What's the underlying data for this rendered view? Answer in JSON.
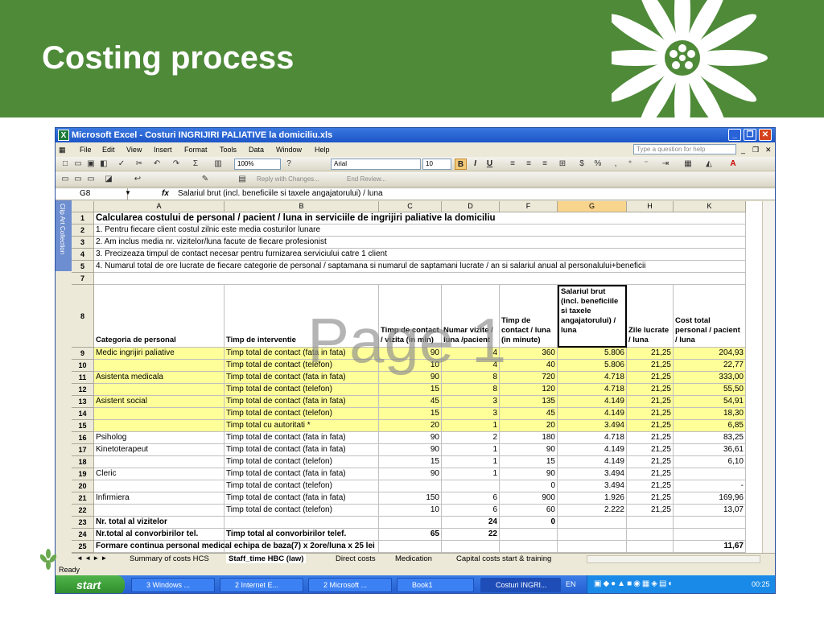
{
  "slide": {
    "title": "Costing process"
  },
  "window": {
    "title": "Microsoft Excel - Costuri INGRIJIRI PALIATIVE la domiciliu.xls",
    "menu": [
      "File",
      "Edit",
      "View",
      "Insert",
      "Format",
      "Tools",
      "Data",
      "Window",
      "Help"
    ],
    "ask_placeholder": "Type a question for help",
    "zoom": "100%",
    "font": "Arial",
    "font_size": "10",
    "reply_label": "Reply with Changes...",
    "end_review_label": "End Review...",
    "name_box": "G8",
    "fx": "fx",
    "formula": "Salariul brut (incl. beneficiile si taxele angajatorului) / luna",
    "clipart_label": "Clip Art Collection"
  },
  "grid": {
    "columns": [
      "A",
      "B",
      "C",
      "D",
      "F",
      "G",
      "H",
      "K"
    ],
    "selected_column": "G",
    "intro_rows": [
      {
        "row": "1",
        "text": "Calcularea costului de personal / pacient / luna in serviciile de ingrijiri paliative la domiciliu"
      },
      {
        "row": "2",
        "text": "1. Pentru fiecare client costul zilnic este media costurilor lunare"
      },
      {
        "row": "3",
        "text": "2. Am inclus media nr. vizitelor/luna facute de fiecare profesionist"
      },
      {
        "row": "4",
        "text": "3. Precizeaza timpul de contact necesar pentru furnizarea serviciului catre 1 client"
      },
      {
        "row": "5",
        "text": "4. Numarul total de ore lucrate de fiecare categorie de personal / saptamana si numarul de saptamani lucrate / an si salariul anual al personalului+beneficii"
      },
      {
        "row": "7",
        "text": ""
      }
    ],
    "header_row": {
      "row": "8",
      "cells": [
        "Categoria de personal",
        "Timp de interventie",
        "Timp de contact / vizita (in min)",
        "Numar vizite / luna /pacient",
        "Timp de contact / luna (in minute)",
        "Salariul brut (incl. beneficiile si taxele angajatorului) / luna",
        "Zile lucrate / luna",
        "Cost total personal / pacient / luna"
      ]
    },
    "data_rows": [
      {
        "row": "9",
        "yellow": true,
        "cells": [
          "Medic ingrijiri paliative",
          "Timp total de contact (fata in fata)",
          "90",
          "4",
          "360",
          "5.806",
          "21,25",
          "204,93"
        ]
      },
      {
        "row": "10",
        "yellow": true,
        "cells": [
          "",
          "Timp total  de contact (telefon)",
          "10",
          "4",
          "40",
          "5.806",
          "21,25",
          "22,77"
        ]
      },
      {
        "row": "11",
        "yellow": true,
        "cells": [
          "Asistenta medicala",
          "Timp total de contact (fata in fata)",
          "90",
          "8",
          "720",
          "4.718",
          "21,25",
          "333,00"
        ]
      },
      {
        "row": "12",
        "yellow": true,
        "cells": [
          "",
          "Timp total  de contact (telefon)",
          "15",
          "8",
          "120",
          "4.718",
          "21,25",
          "55,50"
        ]
      },
      {
        "row": "13",
        "yellow": true,
        "cells": [
          "Asistent social",
          "Timp total de contact (fata in fata)",
          "45",
          "3",
          "135",
          "4.149",
          "21,25",
          "54,91"
        ]
      },
      {
        "row": "14",
        "yellow": true,
        "cells": [
          "",
          "Timp total  de contact (telefon)",
          "15",
          "3",
          "45",
          "4.149",
          "21,25",
          "18,30"
        ]
      },
      {
        "row": "15",
        "yellow": true,
        "cells": [
          "",
          "Timp total cu autoritati *",
          "20",
          "1",
          "20",
          "3.494",
          "21,25",
          "6,85"
        ]
      },
      {
        "row": "16",
        "yellow": false,
        "cells": [
          "Psiholog",
          "Timp total de contact (fata in fata)",
          "90",
          "2",
          "180",
          "4.718",
          "21,25",
          "83,25"
        ]
      },
      {
        "row": "17",
        "yellow": false,
        "cells": [
          "Kinetoterapeut",
          "Timp total de contact (fata in fata)",
          "90",
          "1",
          "90",
          "4.149",
          "21,25",
          "36,61"
        ]
      },
      {
        "row": "18",
        "yellow": false,
        "cells": [
          "",
          "Timp total  de contact (telefon)",
          "15",
          "1",
          "15",
          "4.149",
          "21,25",
          "6,10"
        ]
      },
      {
        "row": "19",
        "yellow": false,
        "cells": [
          "Cleric",
          "Timp total de contact (fata in fata)",
          "90",
          "1",
          "90",
          "3.494",
          "21,25",
          ""
        ]
      },
      {
        "row": "20",
        "yellow": false,
        "cells": [
          "",
          "Timp total  de contact (telefon)",
          "",
          "",
          "0",
          "3.494",
          "21,25",
          "-"
        ]
      },
      {
        "row": "21",
        "yellow": false,
        "cells": [
          "Infirmiera",
          "Timp total de contact (fata in fata)",
          "150",
          "6",
          "900",
          "1.926",
          "21,25",
          "169,96"
        ]
      },
      {
        "row": "22",
        "yellow": false,
        "cells": [
          "",
          "Timp total  de contact (telefon)",
          "10",
          "6",
          "60",
          "2.222",
          "21,25",
          "13,07"
        ]
      },
      {
        "row": "23",
        "yellow": false,
        "bold": true,
        "cells": [
          "Nr. total al vizitelor",
          "",
          "",
          "24",
          "0",
          "",
          "",
          ""
        ]
      },
      {
        "row": "24",
        "yellow": false,
        "bold": true,
        "cells": [
          "Nr.total al convorbirilor tel.",
          "Timp total al convorbirilor telef.",
          "65",
          "22",
          "",
          "",
          "",
          ""
        ]
      },
      {
        "row": "25",
        "yellow": false,
        "bold": true,
        "cells": [
          "Formare continua personal medical echipa de baza(7) x 2ore/luna x 25 lei",
          "",
          "",
          "",
          "",
          "",
          "",
          "11,67"
        ]
      }
    ]
  },
  "watermark": "Page 1",
  "sheet_tabs": [
    "Summary of costs HCS",
    "Staff_time HBC (law)",
    "Direct costs",
    "Medication",
    "Capital costs start & training"
  ],
  "active_sheet": "Staff_time HBC (law)",
  "status": "Ready",
  "taskbar": {
    "start": "start",
    "items": [
      "3 Windows ...",
      "2 Internet E...",
      "2 Microsoft ...",
      "Book1",
      "Costuri INGRI..."
    ],
    "lang": "EN",
    "clock": "00:25"
  }
}
